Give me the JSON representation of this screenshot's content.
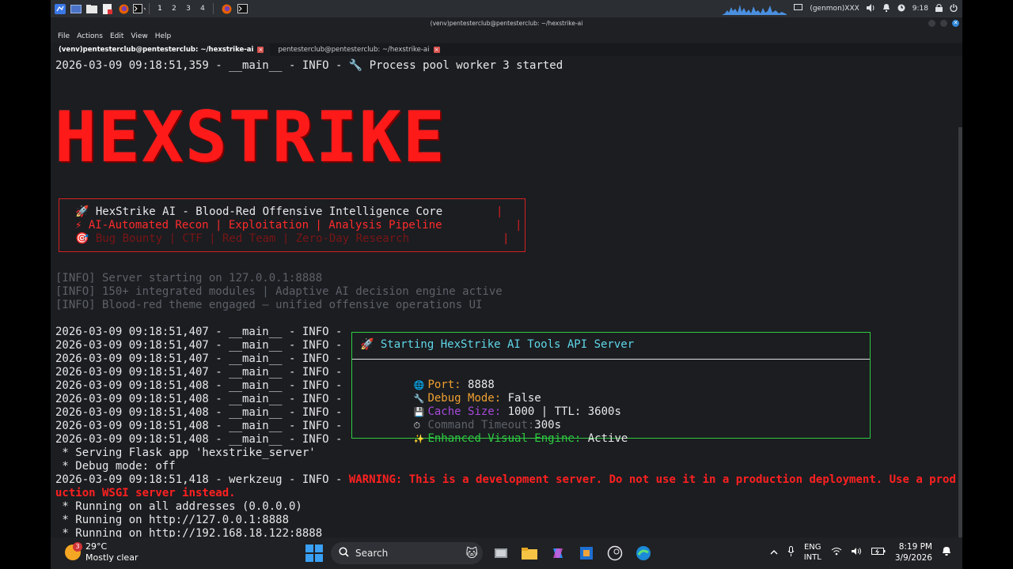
{
  "topbar": {
    "workspaces": [
      "1",
      "2",
      "3",
      "4"
    ],
    "user": "(genmon)XXX",
    "time": "9:18"
  },
  "window": {
    "title": "(venv)pentesterclub@pentesterclub: ~/hexstrike-ai",
    "close_glyph": "✕"
  },
  "menu": [
    "File",
    "Actions",
    "Edit",
    "View",
    "Help"
  ],
  "tabs": [
    {
      "label": "(venv)pentesterclub@pentesterclub: ~/hexstrike-ai",
      "active": true
    },
    {
      "label": "pentesterclub@pentesterclub: ~/hexstrike-ai",
      "active": false
    }
  ],
  "terminal": {
    "first_line": "2026-03-09 09:18:51,359 - __main__ - INFO - 🔧 Process pool worker 3 started",
    "banner": "HEXSTRIKE",
    "infobox": {
      "line1": "🚀 HexStrike AI - Blood-Red Offensive Intelligence Core",
      "line2": "⚡ AI-Automated Recon | Exploitation | Analysis Pipeline",
      "line3": "🎯 Bug Bounty | CTF | Red Team | Zero-Day Research"
    },
    "info_lines": [
      "[INFO] Server starting on 127.0.0.1:8888",
      "[INFO] 150+ integrated modules | Adaptive AI decision engine active",
      "[INFO] Blood-red theme engaged — unified offensive operations UI"
    ],
    "log_lines": [
      "2026-03-09 09:18:51,407 - __main__ - INFO -",
      "2026-03-09 09:18:51,407 - __main__ - INFO -",
      "2026-03-09 09:18:51,407 - __main__ - INFO -",
      "2026-03-09 09:18:51,407 - __main__ - INFO -",
      "2026-03-09 09:18:51,408 - __main__ - INFO -",
      "2026-03-09 09:18:51,408 - __main__ - INFO -",
      "2026-03-09 09:18:51,408 - __main__ - INFO -",
      "2026-03-09 09:18:51,408 - __main__ - INFO -",
      "2026-03-09 09:18:51,408 - __main__ - INFO -"
    ],
    "server_box": {
      "header": "🚀 Starting HexStrike AI Tools API Server",
      "port_label": "Port:",
      "port_value": "8888",
      "debug_label": "Debug Mode:",
      "debug_value": "False",
      "cache_label": "Cache Size:",
      "cache_value": "1000 | TTL: 3600s",
      "timeout_label": "Command Timeout:",
      "timeout_value": "300s",
      "engine_label": "Enhanced Visual Engine:",
      "engine_value": "Active"
    },
    "flask_lines": [
      " * Serving Flask app 'hexstrike_server'",
      " * Debug mode: off"
    ],
    "werkzeug_prefix": "2026-03-09 09:18:51,418 - werkzeug - INFO - ",
    "warning_1": "WARNING: This is a development server. Do not use it in a production deployment. Use a prod",
    "warning_2": "uction WSGI server instead.",
    "running_lines": [
      " * Running on all addresses (0.0.0.0)",
      " * Running on http://127.0.0.1:8888",
      " * Running on http://192.168.18.122:8888"
    ]
  },
  "taskbar": {
    "weather_temp": "29°C",
    "weather_desc": "Mostly clear",
    "weather_badge": "3",
    "search_placeholder": "Search",
    "lang_1": "ENG",
    "lang_2": "INTL",
    "clock_time": "8:19 PM",
    "clock_date": "3/9/2026"
  },
  "colors": {
    "banner_red": "#ff1a1a",
    "box_green": "#2ecc40",
    "warning_red": "#ff2020",
    "cyan": "#5fd7e8"
  }
}
